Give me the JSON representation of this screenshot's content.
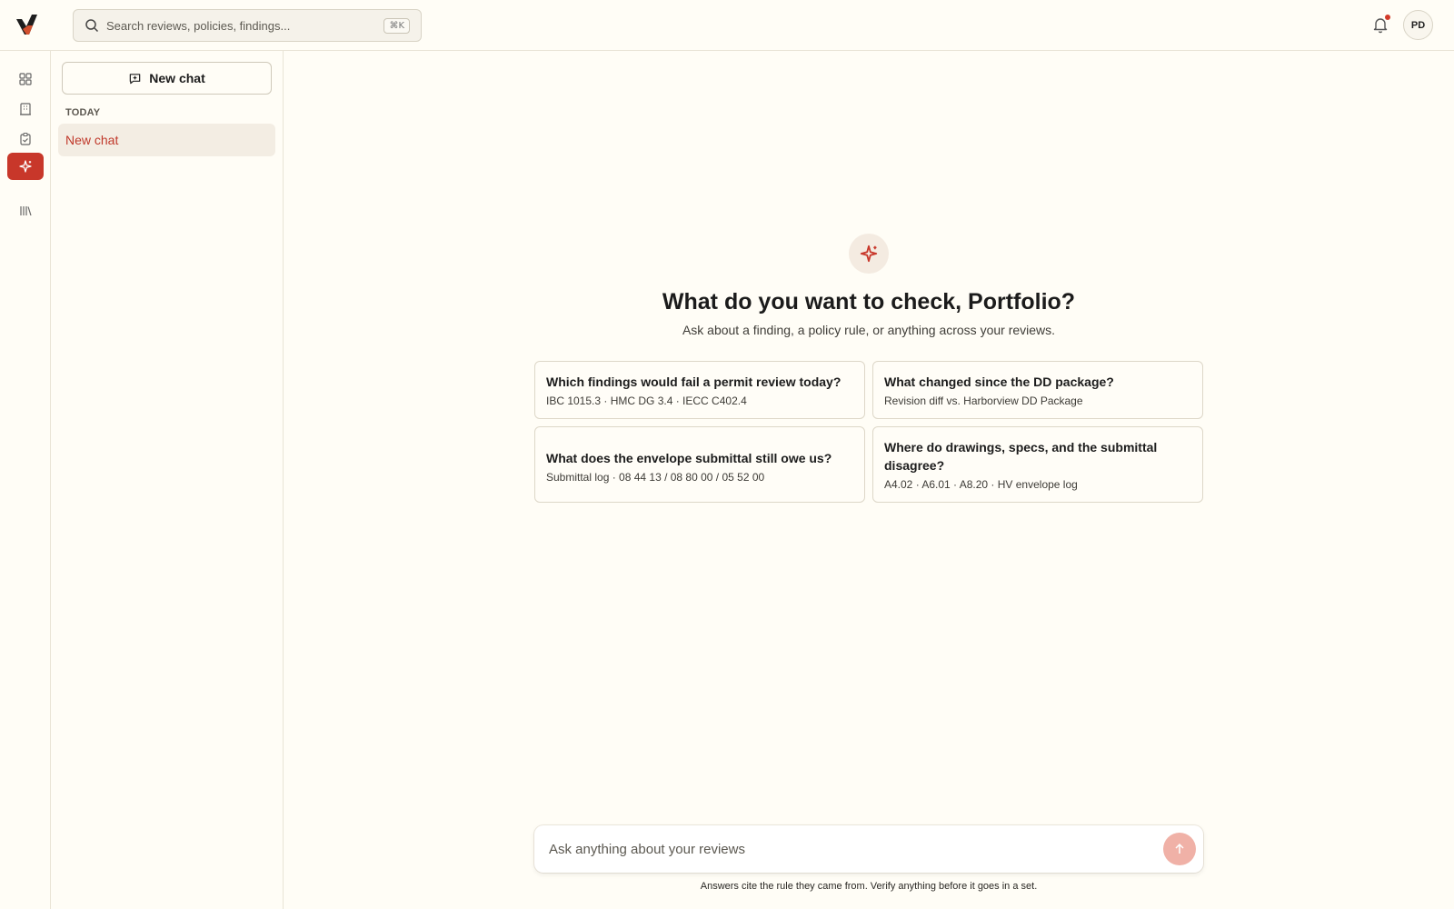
{
  "search": {
    "placeholder": "Search reviews, policies, findings...",
    "shortcut": "⌘K"
  },
  "user": {
    "initials": "PD"
  },
  "rail": {
    "items": [
      {
        "icon": "grid-icon",
        "active": false
      },
      {
        "icon": "building-icon",
        "active": false
      },
      {
        "icon": "clipboard-check-icon",
        "active": false
      },
      {
        "icon": "sparkle-icon",
        "active": true
      },
      {
        "icon": "library-icon",
        "active": false
      }
    ]
  },
  "sidebar": {
    "new_chat_label": "New chat",
    "section_label": "TODAY",
    "chats": [
      {
        "label": "New chat"
      }
    ]
  },
  "main": {
    "title": "What do you want to check, Portfolio?",
    "subtitle": "Ask about a finding, a policy rule, or anything across your reviews.",
    "suggestions": [
      {
        "question": "Which findings would fail a permit review today?",
        "refs": "IBC 1015.3 · HMC DG 3.4 · IECC C402.4"
      },
      {
        "question": "What changed since the DD package?",
        "refs": "Revision diff vs. Harborview DD Package"
      },
      {
        "question": "What does the envelope submittal still owe us?",
        "refs": "Submittal log · 08 44 13 / 08 80 00 / 05 52 00"
      },
      {
        "question": "Where do drawings, specs, and the submittal disagree?",
        "refs": "A4.02 · A6.01 · A8.20 · HV envelope log"
      }
    ]
  },
  "composer": {
    "placeholder": "Ask anything about your reviews"
  },
  "footnote": "Answers cite the rule they came from. Verify anything before it goes in a set.",
  "colors": {
    "accent": "#c8372a",
    "background": "#fffdf6",
    "send_disabled": "#f0b1a7"
  }
}
